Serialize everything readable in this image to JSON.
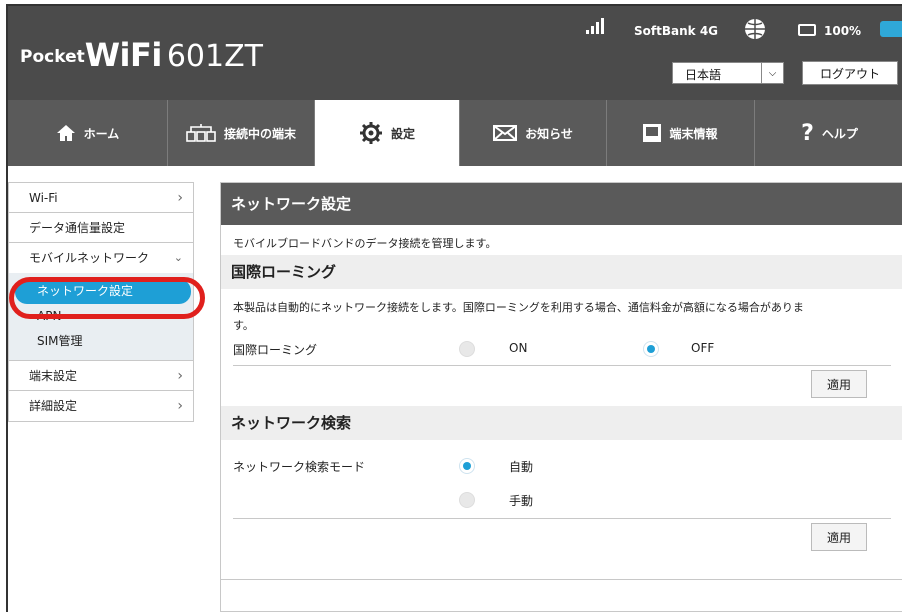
{
  "header": {
    "logo_prefix": "Pocket",
    "logo_brand": "WiFi",
    "logo_model": "601ZT",
    "carrier": "SoftBank",
    "network_type": "4G",
    "battery": "100%",
    "battery_level": 1.0,
    "language": "日本語",
    "logout_label": "ログアウト"
  },
  "nav": {
    "tabs": [
      {
        "label": "ホーム",
        "icon": "home-icon"
      },
      {
        "label": "接続中の端末",
        "icon": "devices-icon"
      },
      {
        "label": "設定",
        "icon": "gear-icon"
      },
      {
        "label": "お知らせ",
        "icon": "mail-icon"
      },
      {
        "label": "端末情報",
        "icon": "device-info-icon"
      },
      {
        "label": "ヘルプ",
        "icon": "help-icon"
      }
    ],
    "active": "設定"
  },
  "sidebar": {
    "wifi": "Wi-Fi",
    "data_usage": "データ通信量設定",
    "mobile_network": "モバイルネットワーク",
    "sub": {
      "network_settings": "ネットワーク設定",
      "apn": "APN",
      "sim": "SIM管理"
    },
    "device_settings": "端末設定",
    "advanced": "詳細設定"
  },
  "content": {
    "title": "ネットワーク設定",
    "description": "モバイルブロードバンドのデータ接続を管理します。",
    "roaming": {
      "heading": "国際ローミング",
      "text": "本製品は自動的にネットワーク接続をします。国際ローミングを利用する場合、通信料金が高額になる場合がありま",
      "text2": "す。",
      "label": "国際ローミング",
      "on": "ON",
      "off": "OFF",
      "selected": "OFF",
      "apply": "適用"
    },
    "search": {
      "heading": "ネットワーク検索",
      "label": "ネットワーク検索モード",
      "auto": "自動",
      "manual": "手動",
      "selected": "自動",
      "apply": "適用"
    }
  },
  "colors": {
    "header_bg": "#4b4b4b",
    "nav_bg": "#5a5a5a",
    "accent": "#1e9fd6",
    "highlight": "#e0201d"
  }
}
